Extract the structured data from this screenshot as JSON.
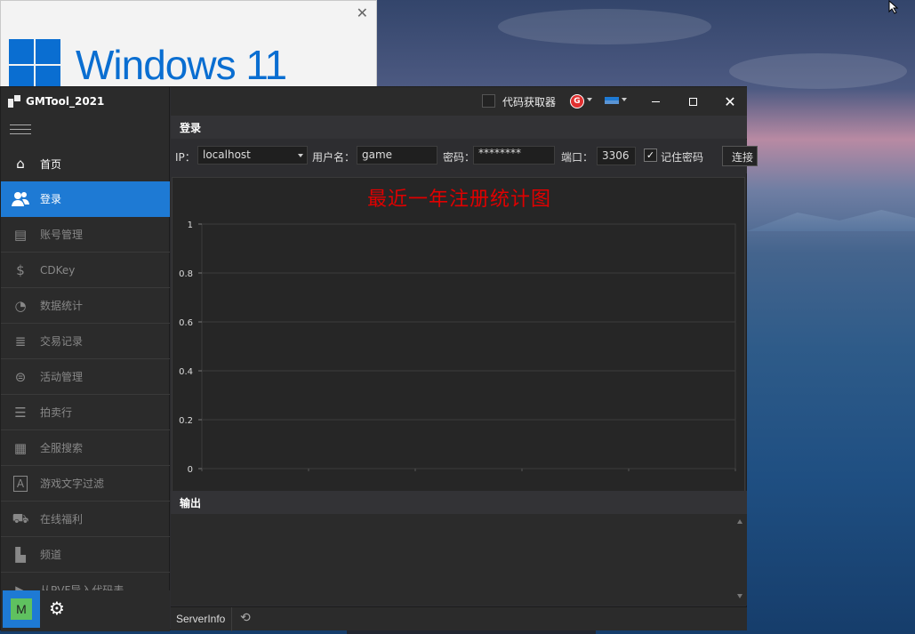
{
  "background_window": {
    "brand": "Windows 11",
    "close_glyph": "✕"
  },
  "app": {
    "title": "GMTool_2021",
    "titlebar": {
      "code_getter_label": "代码获取器",
      "code_getter_checked": false,
      "skin_icon": "palette-icon",
      "flag_icon": "language-flag-icon"
    },
    "sidebar": {
      "items": [
        {
          "label": "首页",
          "icon": "home-icon",
          "glyph": "⌂"
        },
        {
          "label": "登录",
          "icon": "users-icon",
          "glyph": "👥",
          "active": true
        },
        {
          "label": "账号管理",
          "icon": "id-card-icon",
          "glyph": "▤"
        },
        {
          "label": "CDKey",
          "icon": "dollar-icon",
          "glyph": "$"
        },
        {
          "label": "数据统计",
          "icon": "pie-chart-icon",
          "glyph": "◔"
        },
        {
          "label": "交易记录",
          "icon": "log-icon",
          "glyph": "≣"
        },
        {
          "label": "活动管理",
          "icon": "tag-icon",
          "glyph": "⊜"
        },
        {
          "label": "拍卖行",
          "icon": "database-icon",
          "glyph": "☰"
        },
        {
          "label": "全服搜索",
          "icon": "server-icon",
          "glyph": "▦"
        },
        {
          "label": "游戏文字过滤",
          "icon": "text-filter-icon",
          "glyph": "A"
        },
        {
          "label": "在线福利",
          "icon": "truck-icon",
          "glyph": "⛟"
        },
        {
          "label": "频道",
          "icon": "factory-icon",
          "glyph": "▙"
        },
        {
          "label": "从PVF导入代码表",
          "icon": "cursor-icon",
          "glyph": "▶"
        }
      ],
      "bottom_button": "M",
      "settings_icon": "gears-icon"
    },
    "login": {
      "header": "登录",
      "ip_label": "IP：",
      "ip_value": "localhost",
      "username_label": "用户名：",
      "username_value": "game",
      "password_label": "密码：",
      "password_value": "********",
      "port_label": "端口：",
      "port_value": "3306",
      "remember_label": "记住密码",
      "remember_checked": true,
      "connect_label": "连接"
    },
    "output": {
      "header": "输出"
    },
    "status": {
      "server_info": "ServerInfo"
    }
  },
  "chart_data": {
    "type": "line",
    "title": "最近一年注册统计图",
    "series": [],
    "yticks": [
      "0",
      "0.2",
      "0.4",
      "0.6",
      "0.8",
      "1"
    ],
    "ylim": [
      0,
      1
    ],
    "grid": true,
    "xlabel": "",
    "ylabel": ""
  }
}
